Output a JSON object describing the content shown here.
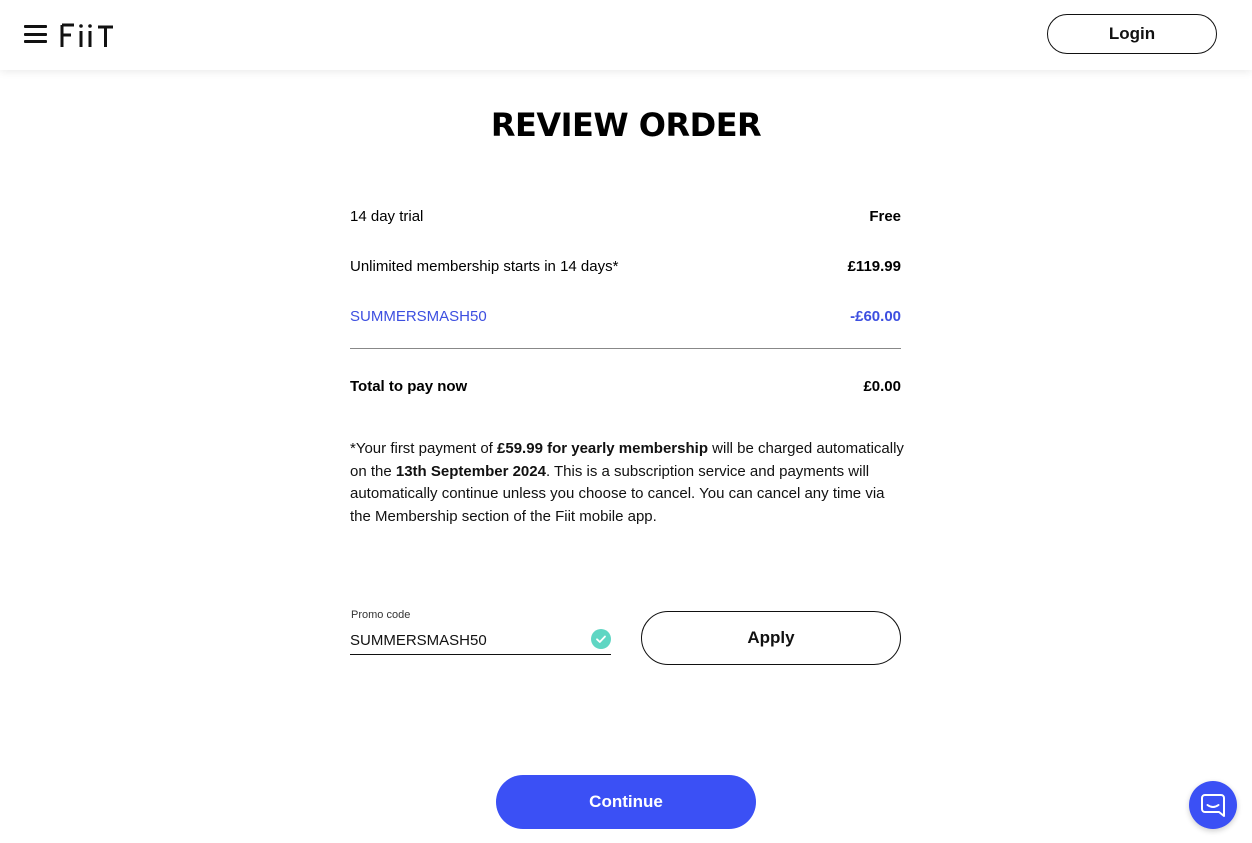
{
  "header": {
    "logo_text": "FiiT",
    "login_label": "Login"
  },
  "page": {
    "title": "REVIEW ORDER"
  },
  "order": {
    "lines": [
      {
        "label": "14 day trial",
        "value": "Free"
      },
      {
        "label": "Unlimited membership starts in 14 days*",
        "value": "£119.99"
      },
      {
        "label": "SUMMERSMASH50",
        "value": "-£60.00"
      }
    ],
    "total_label": "Total to pay now",
    "total_value": "£0.00"
  },
  "note": {
    "part1": "*Your first payment of ",
    "bold1": "£59.99 for yearly membership",
    "part2": " will be charged automatically on the ",
    "bold2": "13th September 2024",
    "part3": ". This is a subscription service and payments will automatically continue unless you choose to cancel. You can cancel any time via the Membership section of the Fiit mobile app."
  },
  "promo": {
    "label": "Promo code",
    "value": "SUMMERSMASH50",
    "apply_label": "Apply",
    "status_icon": "check-circle-icon"
  },
  "actions": {
    "continue_label": "Continue"
  },
  "chat": {
    "icon": "chat-bubble-icon"
  },
  "colors": {
    "accent": "#3b50f5",
    "promo_text": "#3d4fe0",
    "valid_check": "#5fd6c3"
  }
}
